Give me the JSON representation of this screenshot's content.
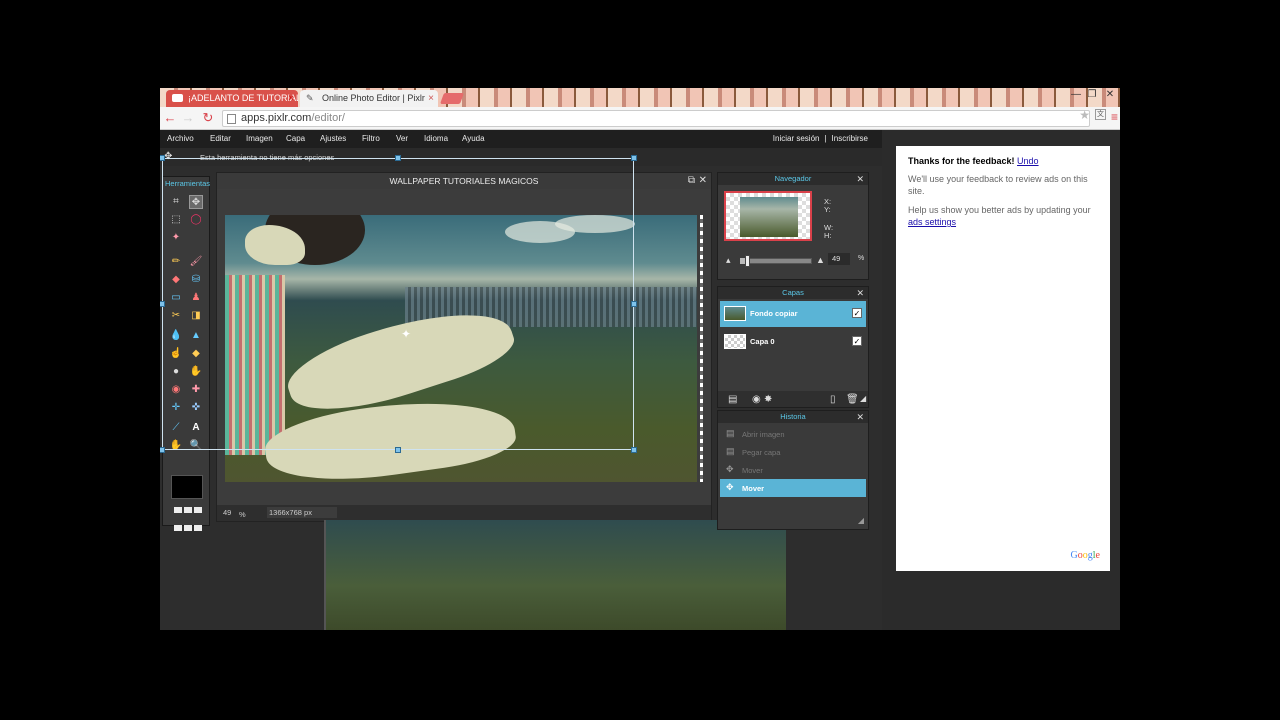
{
  "browser": {
    "tabs": [
      {
        "title": "¡ADELANTO DE TUTORIAL",
        "icon": "youtube-icon"
      },
      {
        "title": "Online Photo Editor | Pixlr",
        "icon": "pixlr-pen-icon"
      }
    ],
    "url_host": "apps.pixlr.com",
    "url_path": "/editor/"
  },
  "menu": {
    "items": [
      "Archivo",
      "Editar",
      "Imagen",
      "Capa",
      "Ajustes",
      "Filtro",
      "Ver",
      "Idioma",
      "Ayuda"
    ],
    "login": "Iniciar sesión",
    "separator": "|",
    "signup": "Inscribirse"
  },
  "options_bar": {
    "text": "Esta herramienta no tiene más opciones"
  },
  "toolbox": {
    "title": "Herramientas",
    "foreground_color": "#000000"
  },
  "document": {
    "title": "WALLPAPER TUTORIALES MAGICOS",
    "zoom": "49",
    "zoom_unit": "%",
    "dimensions": "1366x768 px"
  },
  "navigator": {
    "title": "Navegador",
    "x_label": "X:",
    "y_label": "Y:",
    "w_label": "W:",
    "h_label": "H:",
    "zoom": "49",
    "zoom_unit": "%",
    "zoom_fraction": 0.1
  },
  "layers": {
    "title": "Capas",
    "items": [
      {
        "name": "Fondo copiar",
        "visible": true,
        "selected": true
      },
      {
        "name": "Capa 0",
        "visible": true,
        "selected": false
      }
    ]
  },
  "history": {
    "title": "Historia",
    "items": [
      {
        "label": "Abrir imagen",
        "selected": false
      },
      {
        "label": "Pegar capa",
        "selected": false
      },
      {
        "label": "Mover",
        "selected": false
      },
      {
        "label": "Mover",
        "selected": true
      }
    ]
  },
  "ad": {
    "heading": "Thanks for the feedback!",
    "undo": "Undo",
    "line1": "We'll use your feedback to review ads on this site.",
    "line2": "Help us show you better ads by updating your",
    "link": "ads settings",
    "brand": "Google"
  },
  "colors": {
    "accent": "#5ab4d6",
    "panel_title": "#5bc8e8",
    "brand_red": "#d9414a"
  }
}
